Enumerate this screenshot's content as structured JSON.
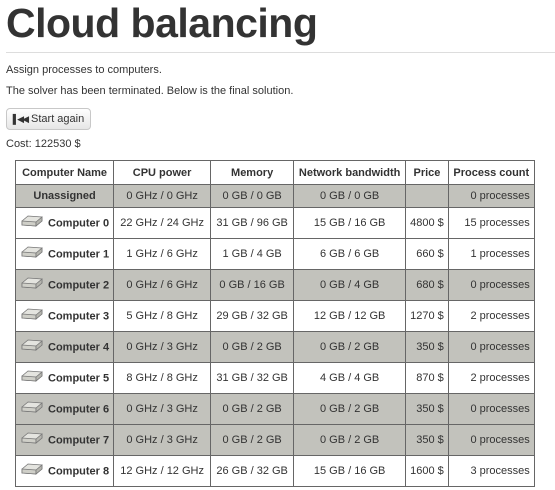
{
  "page": {
    "title": "Cloud balancing",
    "subtitle": "Assign processes to computers.",
    "status": "The solver has been terminated. Below is the final solution.",
    "start_button": "Start again",
    "cost": "Cost: 122530 $"
  },
  "table": {
    "headers": [
      "Computer Name",
      "CPU power",
      "Memory",
      "Network bandwidth",
      "Price",
      "Process count"
    ],
    "rows": [
      {
        "name": "Unassigned",
        "cpu": "0 GHz / 0 GHz",
        "memory": "0 GB / 0 GB",
        "network": "0 GB / 0 GB",
        "price": "",
        "processes": "0 processes",
        "icon": "none"
      },
      {
        "name": "Computer 0",
        "cpu": "22 GHz / 24 GHz",
        "memory": "31 GB / 96 GB",
        "network": "15 GB / 16 GB",
        "price": "4800 $",
        "processes": "15 processes",
        "icon": "computer-icon"
      },
      {
        "name": "Computer 1",
        "cpu": "1 GHz / 6 GHz",
        "memory": "1 GB / 4 GB",
        "network": "6 GB / 6 GB",
        "price": "660 $",
        "processes": "1 processes",
        "icon": "computer-icon"
      },
      {
        "name": "Computer 2",
        "cpu": "0 GHz / 6 GHz",
        "memory": "0 GB / 16 GB",
        "network": "0 GB / 4 GB",
        "price": "680 $",
        "processes": "0 processes",
        "icon": "computer-icon"
      },
      {
        "name": "Computer 3",
        "cpu": "5 GHz / 8 GHz",
        "memory": "29 GB / 32 GB",
        "network": "12 GB / 12 GB",
        "price": "1270 $",
        "processes": "2 processes",
        "icon": "computer-icon"
      },
      {
        "name": "Computer 4",
        "cpu": "0 GHz / 3 GHz",
        "memory": "0 GB / 2 GB",
        "network": "0 GB / 2 GB",
        "price": "350 $",
        "processes": "0 processes",
        "icon": "computer-icon"
      },
      {
        "name": "Computer 5",
        "cpu": "8 GHz / 8 GHz",
        "memory": "31 GB / 32 GB",
        "network": "4 GB / 4 GB",
        "price": "870 $",
        "processes": "2 processes",
        "icon": "computer-icon"
      },
      {
        "name": "Computer 6",
        "cpu": "0 GHz / 3 GHz",
        "memory": "0 GB / 2 GB",
        "network": "0 GB / 2 GB",
        "price": "350 $",
        "processes": "0 processes",
        "icon": "computer-icon"
      },
      {
        "name": "Computer 7",
        "cpu": "0 GHz / 3 GHz",
        "memory": "0 GB / 2 GB",
        "network": "0 GB / 2 GB",
        "price": "350 $",
        "processes": "0 processes",
        "icon": "computer-icon"
      },
      {
        "name": "Computer 8",
        "cpu": "12 GHz / 12 GHz",
        "memory": "26 GB / 32 GB",
        "network": "15 GB / 16 GB",
        "price": "1600 $",
        "processes": "3 processes",
        "icon": "computer-icon"
      }
    ]
  },
  "colors": {
    "unused_row": "#c2c2bc",
    "used_row": "#ffffff",
    "text": "#333333"
  }
}
